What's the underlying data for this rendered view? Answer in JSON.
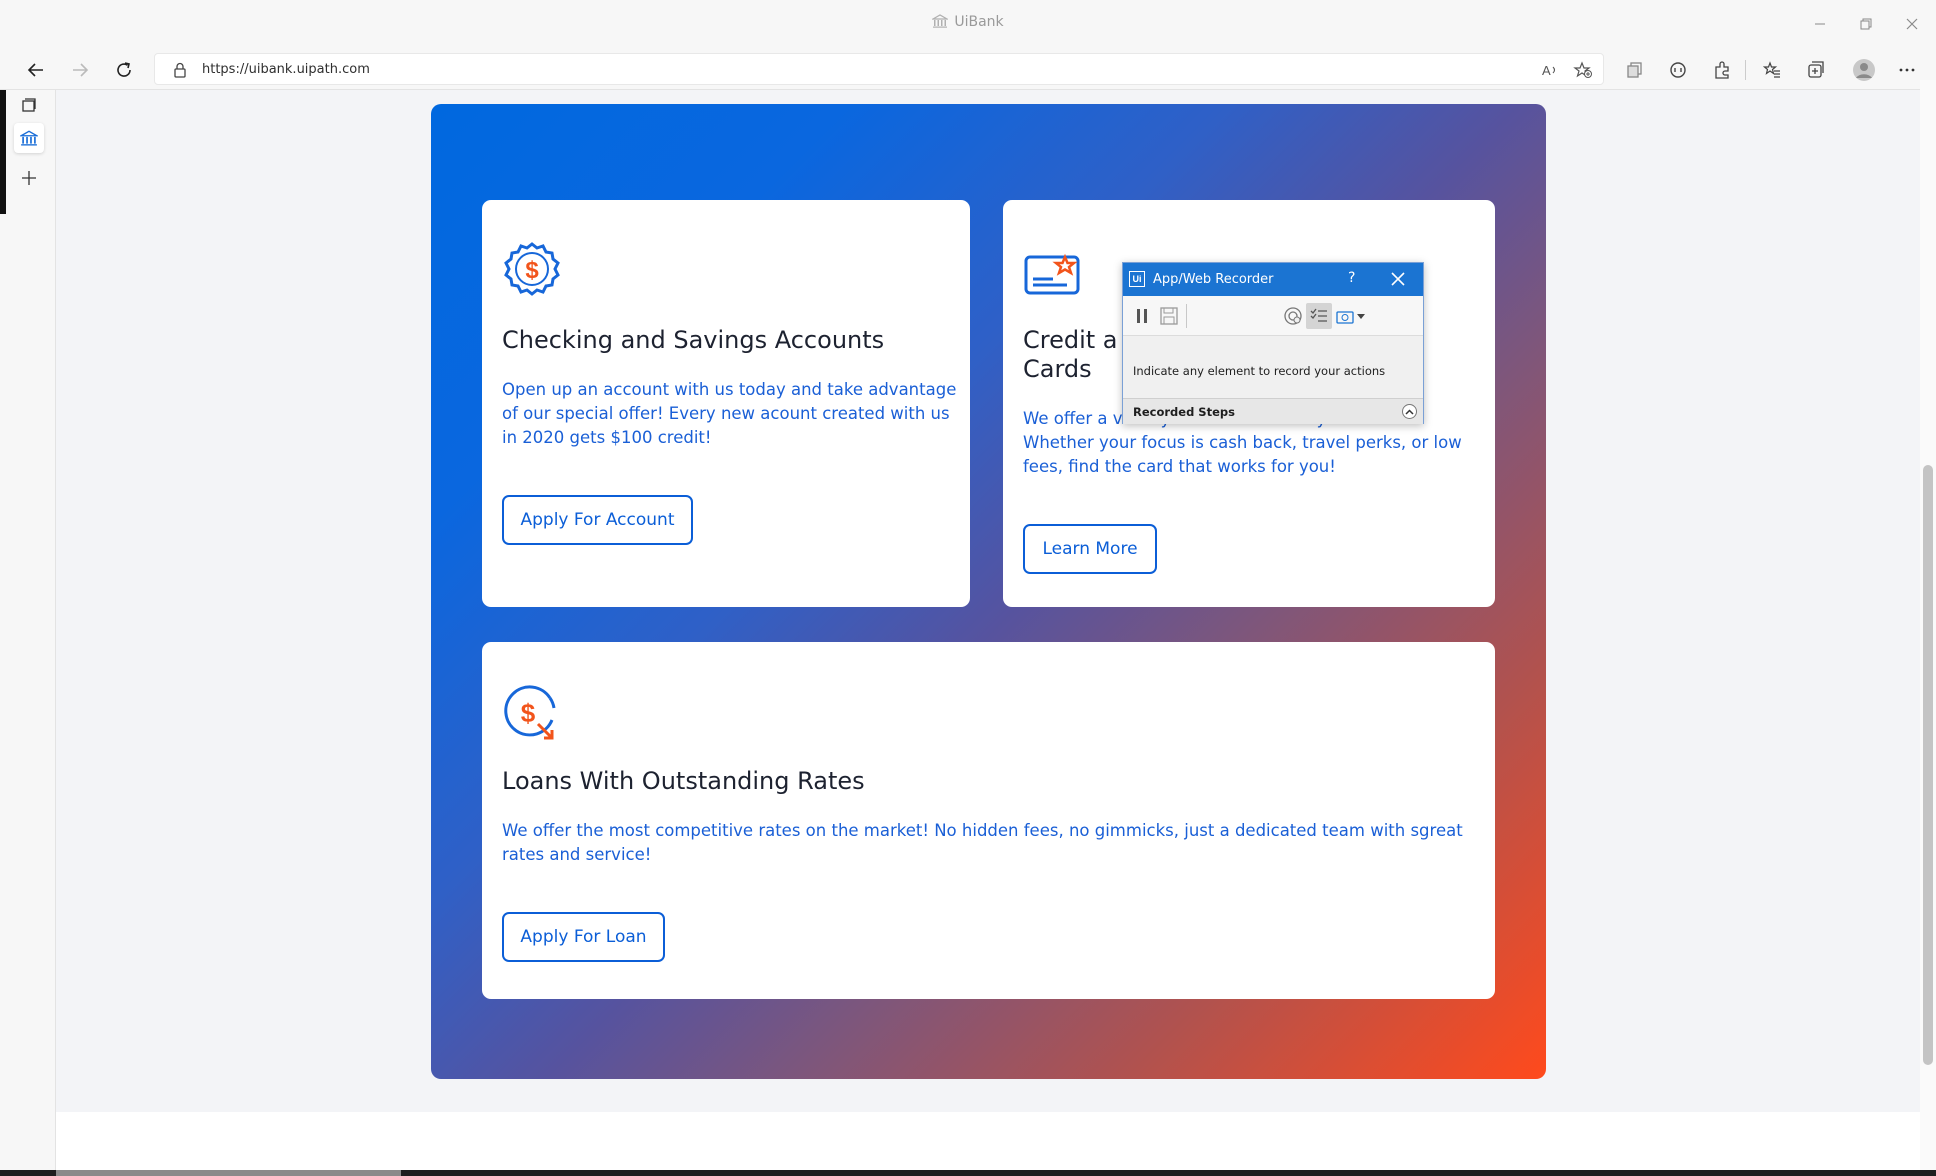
{
  "browser": {
    "window_title": "UiBank",
    "url": "https://uibank.uipath.com"
  },
  "cards": {
    "checking": {
      "title": "Checking and Savings Accounts",
      "body": "Open up an account with us today and take advantage of our special offer! Every new acount created with us in 2020 gets $100 credit!",
      "button": "Apply For Account"
    },
    "credit": {
      "title_line1": "Credit a",
      "title_line2": "Cards",
      "body": "We offer a variety of cards to meet you needs. Whether your focus is cash back, travel perks, or low fees, find the card that works for you!",
      "button": "Learn More"
    },
    "loans": {
      "title": "Loans With Outstanding Rates",
      "body": "We offer the most competitive rates on the market! No hidden fees, no gimmicks, just a dedicated team with sgreat rates and service!",
      "button": "Apply For Loan"
    }
  },
  "recorder": {
    "title": "App/Web Recorder",
    "logo": "Ui",
    "help": "?",
    "hint": "Indicate any element to record your actions",
    "steps_label": "Recorded Steps"
  },
  "colors": {
    "accent_blue": "#0b5ed7",
    "accent_orange": "#ff4a1c",
    "recorder_blue": "#1b74d2"
  },
  "icons": {
    "checking": "dollar-badge-icon",
    "credit": "credit-card-star-icon",
    "loans": "dollar-arrow-icon"
  }
}
